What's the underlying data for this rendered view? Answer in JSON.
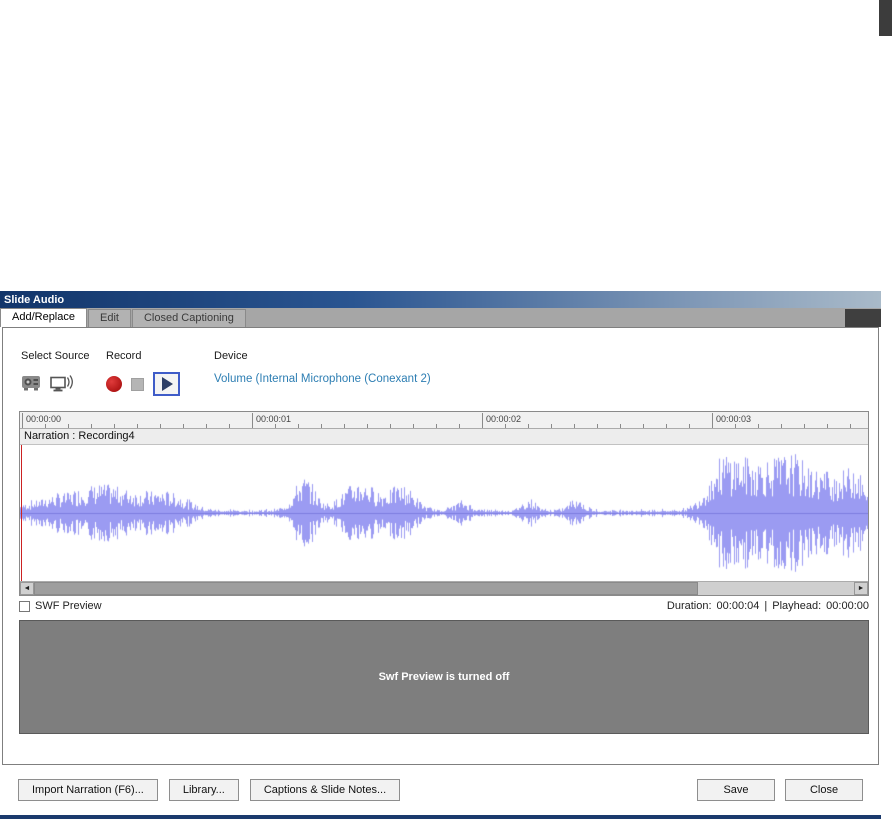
{
  "window": {
    "title": "Slide Audio"
  },
  "tabs": [
    {
      "label": "Add/Replace",
      "active": true
    },
    {
      "label": "Edit",
      "active": false
    },
    {
      "label": "Closed Captioning",
      "active": false
    }
  ],
  "controls": {
    "select_source_label": "Select Source",
    "record_label": "Record",
    "device_label": "Device",
    "device_value": "Volume (Internal Microphone (Conexant 2)"
  },
  "icons": {
    "scroll_left": "◄",
    "scroll_right": "►"
  },
  "timeline": {
    "ruler_ticks": [
      "00:00:00",
      "00:00:01",
      "00:00:02",
      "00:00:03"
    ],
    "track_label": "Narration : Recording4"
  },
  "status": {
    "swf_preview_label": "SWF Preview",
    "duration_label": "Duration:",
    "duration_value": "00:00:04",
    "divider": "|",
    "playhead_label": "Playhead:",
    "playhead_value": "00:00:00"
  },
  "preview": {
    "message": "Swf Preview is turned off"
  },
  "footer": {
    "import_label": "Import Narration (F6)...",
    "library_label": "Library...",
    "captions_label": "Captions & Slide Notes...",
    "save_label": "Save",
    "close_label": "Close"
  },
  "colors": {
    "titlebar_start": "#12356a",
    "titlebar_end": "#a9bac9",
    "waveform": "#9b9bf2",
    "waveform_centerline": "#7d7de0",
    "device_link": "#2d7eb3",
    "playhead": "#cc2222",
    "preview_bg": "#7e7e7e"
  },
  "waveform": {
    "duration_seconds": 4,
    "bursts": [
      {
        "center": 0.05,
        "width": 0.035,
        "amp": 14
      },
      {
        "center": 0.09,
        "width": 0.02,
        "amp": 10
      },
      {
        "center": 0.13,
        "width": 0.03,
        "amp": 16
      },
      {
        "center": 0.18,
        "width": 0.02,
        "amp": 12
      },
      {
        "center": 0.335,
        "width": 0.012,
        "amp": 30
      },
      {
        "center": 0.4,
        "width": 0.02,
        "amp": 26
      },
      {
        "center": 0.45,
        "width": 0.015,
        "amp": 22
      },
      {
        "center": 0.52,
        "width": 0.01,
        "amp": 8
      },
      {
        "center": 0.6,
        "width": 0.008,
        "amp": 10
      },
      {
        "center": 0.655,
        "width": 0.008,
        "amp": 12
      },
      {
        "center": 0.83,
        "width": 0.018,
        "amp": 46
      },
      {
        "center": 0.87,
        "width": 0.02,
        "amp": 40
      },
      {
        "center": 0.91,
        "width": 0.018,
        "amp": 44
      },
      {
        "center": 0.955,
        "width": 0.02,
        "amp": 34
      },
      {
        "center": 0.985,
        "width": 0.01,
        "amp": 30
      }
    ]
  }
}
